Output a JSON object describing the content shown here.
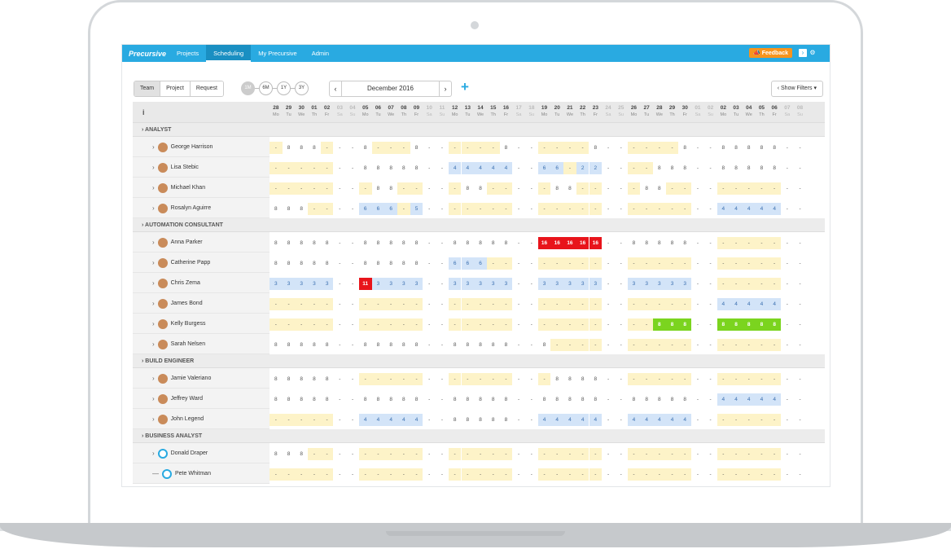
{
  "nav": {
    "logo": "Precursive",
    "items": [
      "Projects",
      "Scheduling",
      "My Precursive",
      "Admin"
    ],
    "active": 1,
    "feedback": "Feedback"
  },
  "toolbar": {
    "views": [
      "Team",
      "Project",
      "Request"
    ],
    "active_view": 0,
    "zoom": [
      "1M",
      "6M",
      "1Y",
      "3Y"
    ],
    "active_zoom": 0,
    "month": "December 2016",
    "filters": "Show Filters"
  },
  "header": {
    "info": "i"
  },
  "days": [
    [
      "28",
      "Mo"
    ],
    [
      "29",
      "Tu"
    ],
    [
      "30",
      "We"
    ],
    [
      "01",
      "Th"
    ],
    [
      "02",
      "Fr"
    ],
    [
      "03",
      "Sa"
    ],
    [
      "04",
      "Su"
    ],
    [
      "05",
      "Mo"
    ],
    [
      "06",
      "Tu"
    ],
    [
      "07",
      "We"
    ],
    [
      "08",
      "Th"
    ],
    [
      "09",
      "Fr"
    ],
    [
      "10",
      "Sa"
    ],
    [
      "11",
      "Su"
    ],
    [
      "12",
      "Mo"
    ],
    [
      "13",
      "Tu"
    ],
    [
      "14",
      "We"
    ],
    [
      "15",
      "Th"
    ],
    [
      "16",
      "Fr"
    ],
    [
      "17",
      "Sa"
    ],
    [
      "18",
      "Su"
    ],
    [
      "19",
      "Mo"
    ],
    [
      "20",
      "Tu"
    ],
    [
      "21",
      "We"
    ],
    [
      "22",
      "Th"
    ],
    [
      "23",
      "Fr"
    ],
    [
      "24",
      "Sa"
    ],
    [
      "25",
      "Su"
    ],
    [
      "26",
      "Mo"
    ],
    [
      "27",
      "Tu"
    ],
    [
      "28",
      "We"
    ],
    [
      "29",
      "Th"
    ],
    [
      "30",
      "Fr"
    ],
    [
      "01",
      "Sa"
    ],
    [
      "02",
      "Su"
    ],
    [
      "02",
      "Mo"
    ],
    [
      "03",
      "Tu"
    ],
    [
      "04",
      "We"
    ],
    [
      "05",
      "Th"
    ],
    [
      "06",
      "Fr"
    ],
    [
      "07",
      "Sa"
    ],
    [
      "08",
      "Su"
    ]
  ],
  "groups": [
    {
      "name": "ANALYST",
      "rows": [
        {
          "name": "George Harrison",
          "cells": "y- 8 8 8 y- - - 8 y- y- y- 8 - - y- y- y- y- 8 - - y- y- y- y- 8 - - y- y- y- y- 8 - - 8 8 8 8 8 - -"
        },
        {
          "name": "Lisa Stebic",
          "cells": "y- y- y- y- y- - - 8 8 8 8 8 - - b4 b4 b4 b4 b4 - - b6 b6 y- b2 b2 - - y- y- 8 8 8 - - 8 8 8 8 8 - -"
        },
        {
          "name": "Michael Khan",
          "cells": "y- y- y- y- y- - - y- 8 8 y- y- - - y- 8 8 y- y- - - y- 8 8 y- y- - - y- 8 8 y- y- - - y- y- y- y- y- - -"
        },
        {
          "name": "Rosalyn Aguirre",
          "cells": "8 8 8 y- y- - - b6 b6 b6 y- b5 - - y- y- y- y- y- - - y- y- y- y- y- - - y- y- y- y- y- - - b4 b4 b4 b4 b4 - -"
        }
      ]
    },
    {
      "name": "AUTOMATION CONSULTANT",
      "rows": [
        {
          "name": "Anna Parker",
          "cells": "8 8 8 8 8 - - 8 8 8 8 8 - - 8 8 8 8 8 - - r16 r16 r16 r16 r16 - - 8 8 8 8 8 - - y- y- y- y- y- - -"
        },
        {
          "name": "Catherine Papp",
          "cells": "8 8 8 8 8 - - 8 8 8 8 8 - - b6 b6 b6 y- y- - - y- y- y- y- y- - - y- y- y- y- y- - - y- y- y- y- y- - -"
        },
        {
          "name": "Chris Zema",
          "cells": "b3 b3 b3 b3 b3 - - r11 b3 b3 b3 b3 - - b3 b3 b3 b3 b3 - - b3 b3 b3 b3 b3 - - b3 b3 b3 b3 b3 - - y- y- y- y- y- - -"
        },
        {
          "name": "James Bond",
          "cells": "y- y- y- y- y- - - y- y- y- y- y- - - y- y- y- y- y- - - y- y- y- y- y- - - y- y- y- y- y- - - b4 b4 b4 b4 b4 - -"
        },
        {
          "name": "Kelly Burgess",
          "cells": "y- y- y- y- y- - - y- y- y- y- y- - - y- y- y- y- y- - - y- y- y- y- y- - - y- y- g8 g8 g8 - - g8 g8 g8 g8 g8 - -"
        },
        {
          "name": "Sarah Nelsen",
          "cells": "8 8 8 8 8 - - 8 8 8 8 8 - - 8 8 8 8 8 - - 8 y- y- y- y- - - y- y- y- y- y- - - y- y- y- y- y- - -"
        }
      ]
    },
    {
      "name": "BUILD ENGINEER",
      "rows": [
        {
          "name": "Jamie Valeriano",
          "cells": "8 8 8 8 8 - - y- y- y- y- y- - - y- y- y- y- y- - - y- 8 8 8 8 - - y- y- y- y- y- - - y- y- y- y- y- - -"
        },
        {
          "name": "Jeffrey Ward",
          "cells": "8 8 8 8 8 - - 8 8 8 8 8 - - 8 8 8 8 8 - - 8 8 8 8 8 - - 8 8 8 8 8 - - b4 b4 b4 b4 b4 - -"
        },
        {
          "name": "John Legend",
          "cells": "y- y- y- y- y- - - b4 b4 b4 b4 b4 - - 8 8 8 8 8 - - b4 b4 b4 b4 b4 - - b4 b4 b4 b4 b4 - - y- y- y- y- y- - -"
        }
      ]
    },
    {
      "name": "BUSINESS ANALYST",
      "rows": [
        {
          "name": "Donald Draper",
          "cells": "8 8 8 y- y- - - y- y- y- y- y- - - y- y- y- y- y- - - y- y- y- y- y- - - y- y- y- y- y- - - y- y- y- y- y- - -"
        },
        {
          "name": "Pete Whitman",
          "cells": "y- y- y- y- y- - - y- y- y- y- y- - - y- y- y- y- y- - - y- y- y- y- y- - - y- y- y- y- y- - - y- y- y- y- y- - -"
        }
      ]
    }
  ]
}
